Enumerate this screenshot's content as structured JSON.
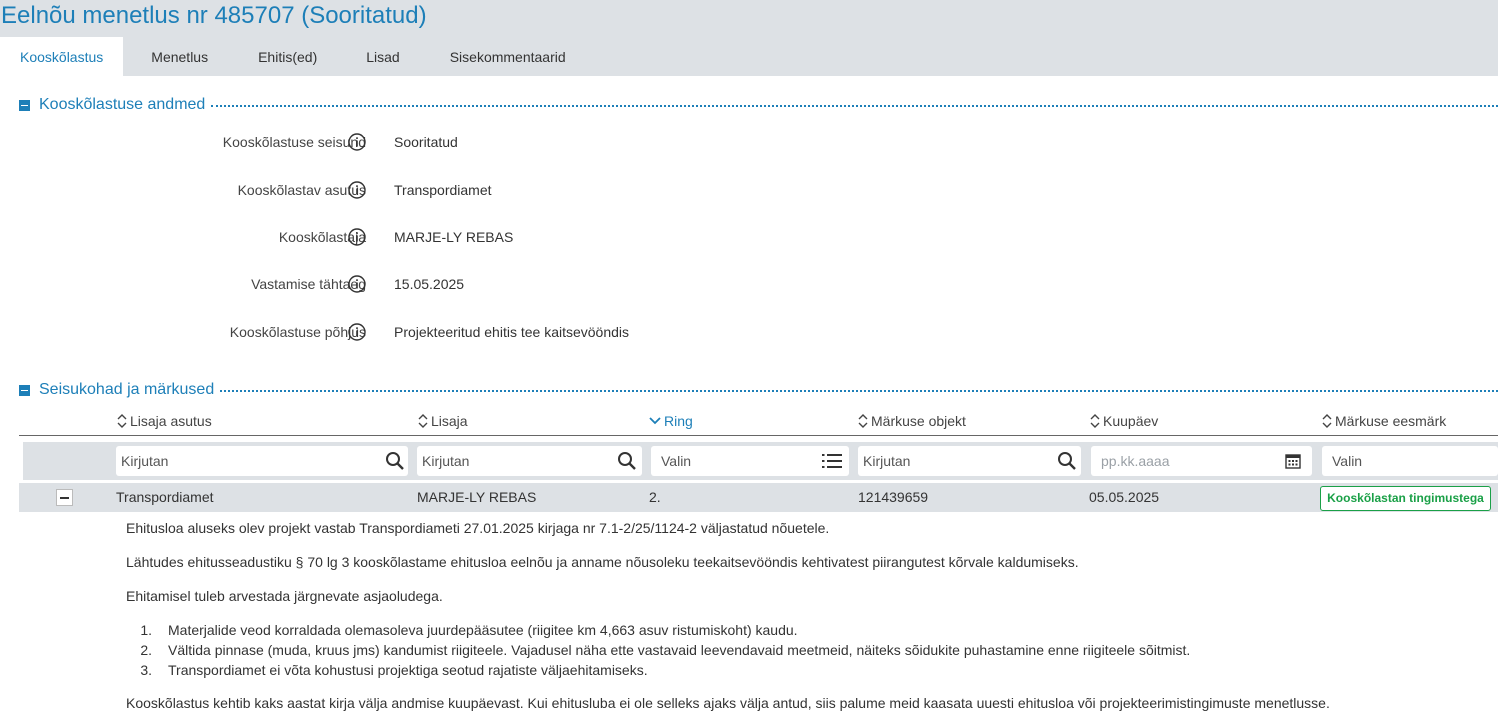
{
  "header": {
    "title": "Eelnõu menetlus nr 485707 (Sooritatud)",
    "tabs": [
      {
        "label": "Kooskõlastus",
        "active": true
      },
      {
        "label": "Menetlus"
      },
      {
        "label": "Ehitis(ed)"
      },
      {
        "label": "Lisad"
      },
      {
        "label": "Sisekommentaarid"
      }
    ]
  },
  "details_section": {
    "title": "Kooskõlastuse andmed",
    "fields": [
      {
        "label": "Kooskõlastuse seisund",
        "value": "Sooritatud"
      },
      {
        "label": "Kooskõlastav asutus",
        "value": "Transpordiamet"
      },
      {
        "label": "Kooskõlastaja",
        "value": "MARJE-LY REBAS"
      },
      {
        "label": "Vastamise tähtaeg",
        "value": "15.05.2025"
      },
      {
        "label": "Kooskõlastuse põhjus",
        "value": "Projekteeritud ehitis tee kaitsevööndis"
      }
    ]
  },
  "remarks_section": {
    "title": "Seisukohad ja märkused",
    "columns": [
      {
        "label": "Lisaja asutus",
        "sort": "both"
      },
      {
        "label": "Lisaja",
        "sort": "both"
      },
      {
        "label": "Ring",
        "sort": "desc"
      },
      {
        "label": "Märkuse objekt",
        "sort": "both"
      },
      {
        "label": "Kuupäev",
        "sort": "both"
      },
      {
        "label": "Märkuse eesmärk",
        "sort": "both"
      }
    ],
    "filters": {
      "lisaja_asutus": "Kirjutan",
      "lisaja": "Kirjutan",
      "ring": "Valin",
      "markuse_objekt": "Kirjutan",
      "kuupaev_placeholder": "pp.kk.aaaa",
      "markuse_eesmark": "Valin"
    },
    "row": {
      "lisaja_asutus": "Transpordiamet",
      "lisaja": "MARJE-LY REBAS",
      "ring": "2.",
      "markuse_objekt": "121439659",
      "kuupaev": "05.05.2025",
      "markuse_eesmark": "Kooskõlastan tingimustega"
    },
    "detail": {
      "p1": "Ehitusloa aluseks olev projekt vastab Transpordiameti 27.01.2025 kirjaga nr 7.1-2/25/1124-2 väljastatud nõuetele.",
      "p2": "Lähtudes ehitusseadustiku § 70 lg 3 kooskõlastame ehitusloa eelnõu ja anname nõusoleku teekaitsevööndis kehtivatest piirangutest kõrvale kaldumiseks.",
      "p3": "Ehitamisel tuleb arvestada järgnevate asjaoludega.",
      "list": [
        "Materjalide veod korraldada olemasoleva juurdepääsutee (riigitee km 4,663 asuv ristumiskoht) kaudu.",
        "Vältida pinnase (muda, kruus jms) kandumist riigiteele. Vajadusel näha ette vastavaid leevendavaid meetmeid, näiteks sõidukite puhastamine enne riigiteele sõitmist.",
        "Transpordiamet ei võta kohustusi projektiga seotud rajatiste väljaehitamiseks."
      ],
      "list_numbers": [
        "1.",
        "2.",
        "3."
      ],
      "p4": "Kooskõlastus kehtib kaks aastat kirja välja andmise kuupäevast. Kui ehitusluba ei ole selleks ajaks välja antud, siis palume meid kaasata uuesti ehitusloa või projekteerimistingimuste menetlusse."
    }
  },
  "colors": {
    "accent": "#1d7fb8",
    "header_bg": "#dde1e5",
    "success": "#1aa047"
  }
}
